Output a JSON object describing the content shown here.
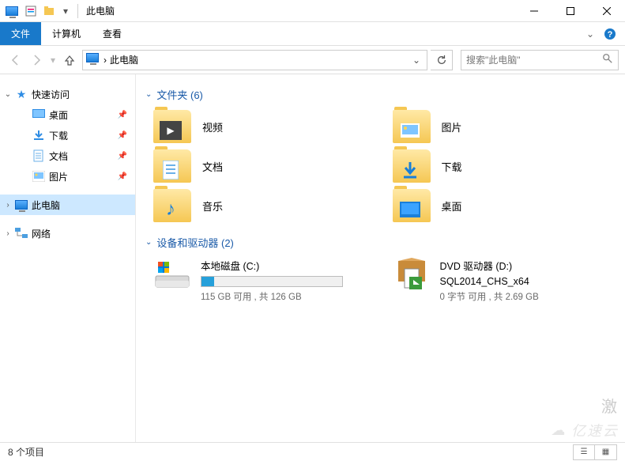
{
  "titlebar": {
    "title": "此电脑"
  },
  "ribbon": {
    "tabs": {
      "file": "文件",
      "computer": "计算机",
      "view": "查看"
    }
  },
  "navbar": {
    "crumb_sep": "›",
    "location": "此电脑",
    "search_placeholder": "搜索\"此电脑\""
  },
  "navpane": {
    "quick_access": "快速访问",
    "desktop": "桌面",
    "downloads": "下载",
    "documents": "文档",
    "pictures": "图片",
    "this_pc": "此电脑",
    "network": "网络"
  },
  "sections": {
    "folders_header": "文件夹 (6)",
    "devices_header": "设备和驱动器 (2)"
  },
  "folders": {
    "videos": "视频",
    "pictures": "图片",
    "documents": "文档",
    "downloads": "下载",
    "music": "音乐",
    "desktop": "桌面"
  },
  "drives": {
    "c": {
      "name": "本地磁盘 (C:)",
      "stat": "115 GB 可用 , 共 126 GB",
      "fill_percent": 9
    },
    "d": {
      "name": "DVD 驱动器 (D:)",
      "label": "SQL2014_CHS_x64",
      "stat": "0 字节 可用 , 共 2.69 GB"
    }
  },
  "statusbar": {
    "count": "8 个项目"
  },
  "watermark": "亿速云",
  "watermark_glyph": "☁"
}
